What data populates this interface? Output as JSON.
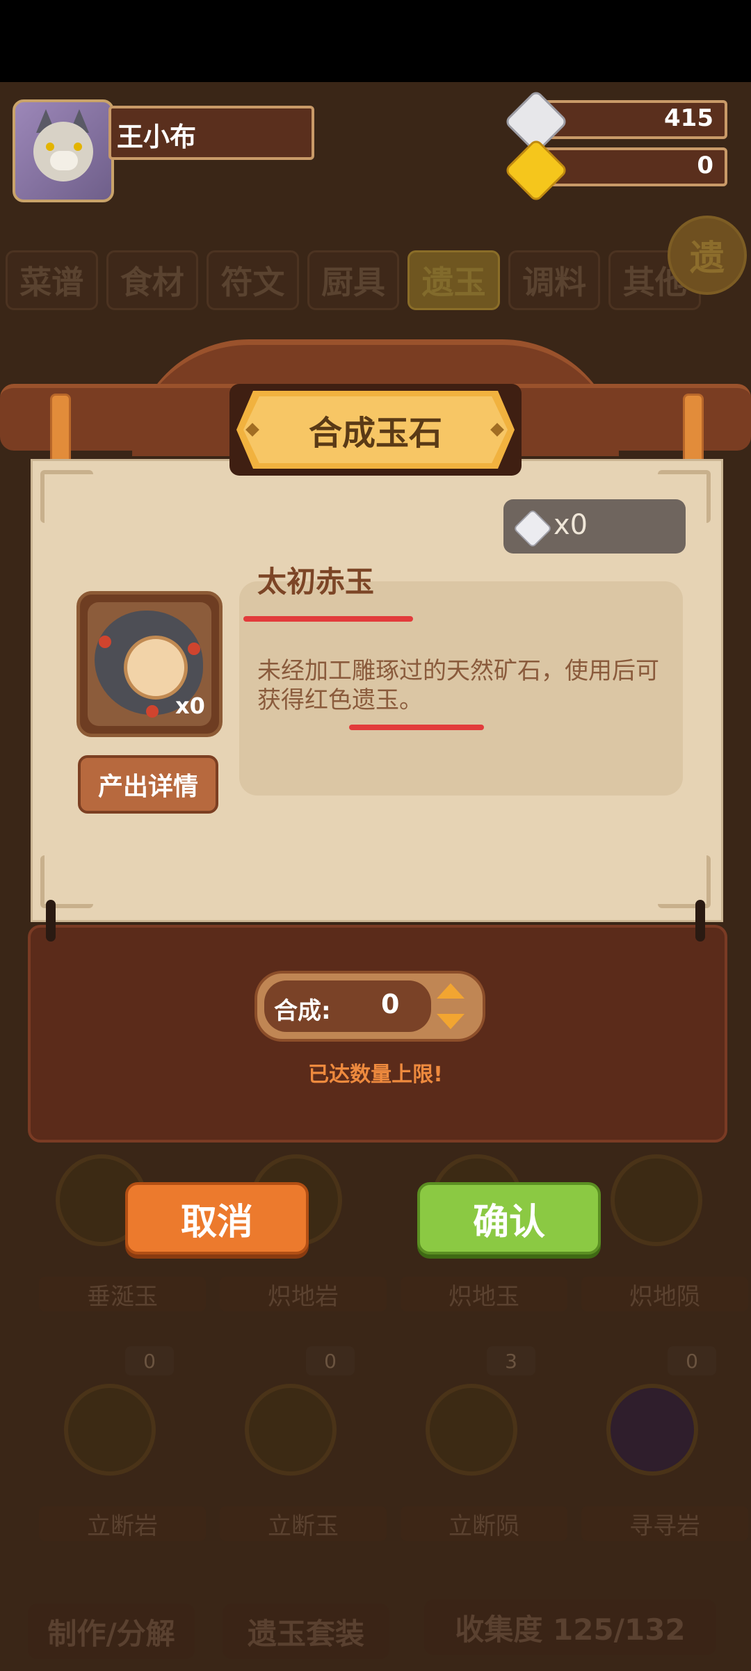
{
  "header": {
    "player_name": "王小布",
    "currency_silver": "415",
    "currency_gold": "0"
  },
  "tabs": [
    "菜谱",
    "食材",
    "符文",
    "厨具",
    "遗玉",
    "调料",
    "其他"
  ],
  "active_tab_index": 4,
  "corner_button": "遗",
  "background_grid": {
    "row1_labels": [
      "垂涎玉",
      "炽地岩",
      "炽地玉",
      "炽地陨"
    ],
    "row2_counts": [
      "0",
      "0",
      "3",
      "0"
    ],
    "row2_labels": [
      "立断岩",
      "立断玉",
      "立断陨",
      "寻寻岩"
    ]
  },
  "bottom_bar": {
    "craft": "制作/分解",
    "set": "遗玉套装",
    "collection": "收集度 125/132"
  },
  "dialog": {
    "title": "合成玉石",
    "stone_count": "x0",
    "item_name": "太初赤玉",
    "item_count": "x0",
    "description": "未经加工雕琢过的天然矿石，使用后可获得红色遗玉。",
    "detail_button": "产出详情",
    "stepper_label": "合成:",
    "stepper_value": "0",
    "limit_message": "已达数量上限!",
    "cancel": "取消",
    "confirm": "确认"
  },
  "colors": {
    "cancel_bg": "#ec7a2d",
    "confirm_bg": "#8bc943",
    "title_plate": "#f7c665",
    "underline": "#e23b3b",
    "limit_text": "#ee8a3e"
  }
}
